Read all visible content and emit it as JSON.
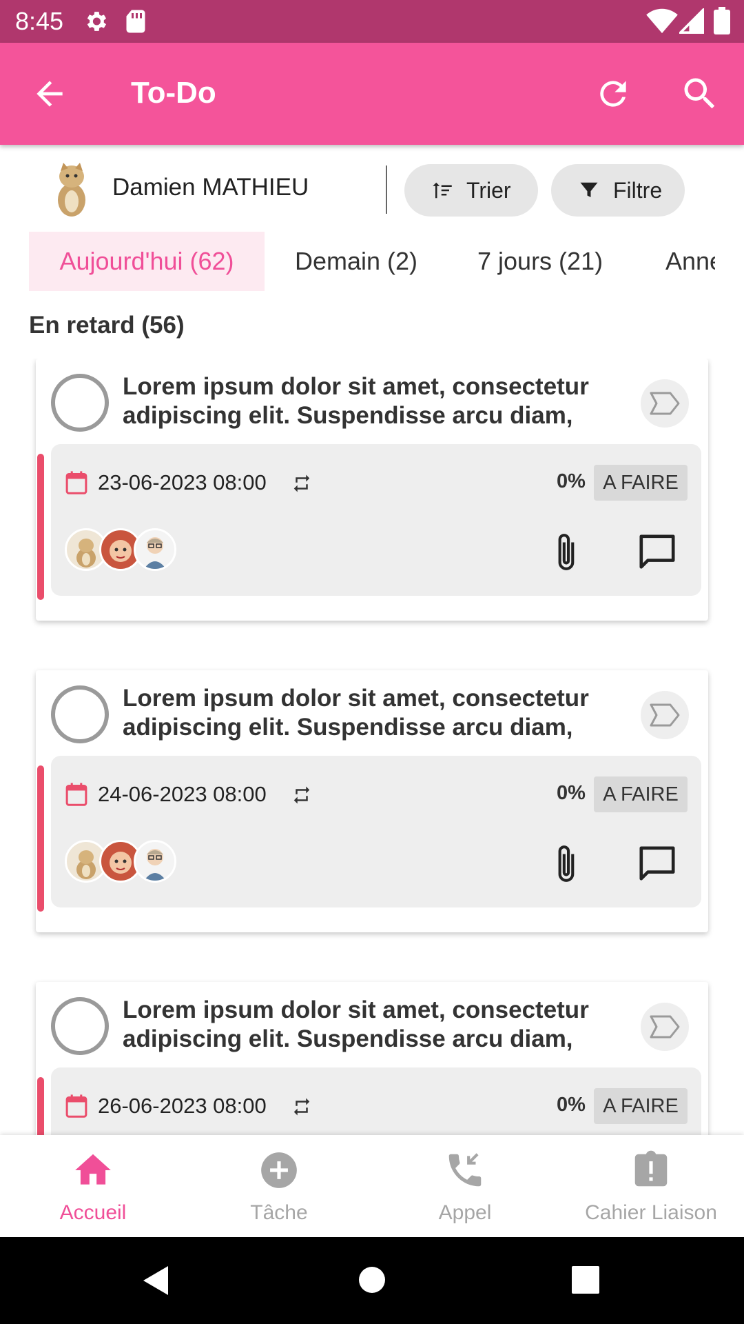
{
  "status_bar": {
    "time": "8:45"
  },
  "app_bar": {
    "title": "To-Do"
  },
  "user": {
    "name": "Damien MATHIEU"
  },
  "toolbar": {
    "sort_label": "Trier",
    "filter_label": "Filtre"
  },
  "tabs": [
    {
      "label": "Aujourd'hui (62)",
      "active": true
    },
    {
      "label": "Demain (2)",
      "active": false
    },
    {
      "label": "7 jours (21)",
      "active": false
    },
    {
      "label": "Anne",
      "active": false
    }
  ],
  "section": {
    "title": "En retard (56)"
  },
  "tasks": [
    {
      "title": "Lorem ipsum dolor sit amet, consectetur adipiscing elit. Suspendisse arcu diam,",
      "date": "23-06-2023 08:00",
      "progress": "0%",
      "status": "A FAIRE"
    },
    {
      "title": "Lorem ipsum dolor sit amet, consectetur adipiscing elit. Suspendisse arcu diam,",
      "date": "24-06-2023 08:00",
      "progress": "0%",
      "status": "A FAIRE"
    },
    {
      "title": "Lorem ipsum dolor sit amet, consectetur adipiscing elit. Suspendisse arcu diam,",
      "date": "26-06-2023 08:00",
      "progress": "0%",
      "status": "A FAIRE"
    }
  ],
  "bottom_nav": [
    {
      "label": "Accueil",
      "icon": "home-icon",
      "active": true
    },
    {
      "label": "Tâche",
      "icon": "add-circle-icon",
      "active": false
    },
    {
      "label": "Appel",
      "icon": "phone-incoming-icon",
      "active": false
    },
    {
      "label": "Cahier Liaison",
      "icon": "clipboard-alert-icon",
      "active": false
    }
  ],
  "colors": {
    "status_bar": "#b0376d",
    "app_bar": "#f4549a",
    "accent": "#f04f98",
    "overdue_bar": "#ea4d6b"
  }
}
